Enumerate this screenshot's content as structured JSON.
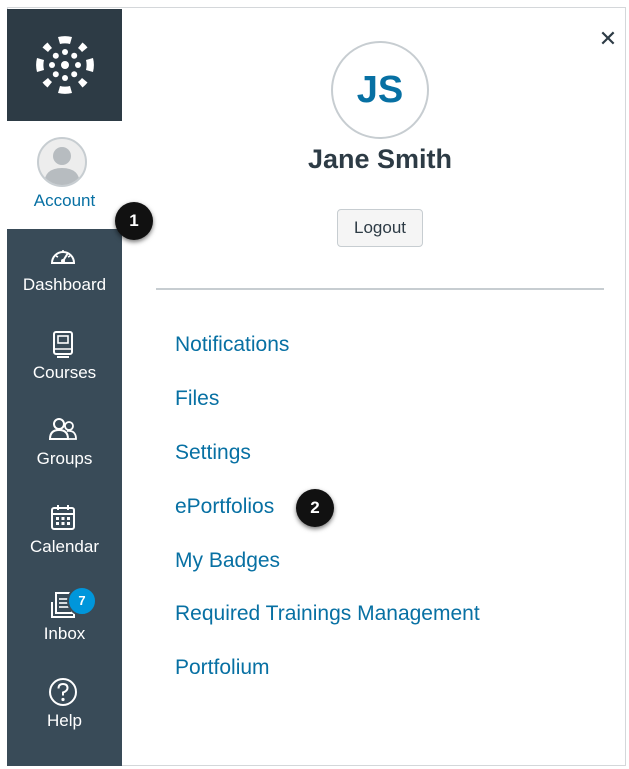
{
  "nav": {
    "logo_icon": "canvas-logo-icon",
    "account": {
      "label": "Account",
      "icon": "user-avatar-icon"
    },
    "items": [
      {
        "label": "Dashboard",
        "icon": "dashboard-gauge-icon"
      },
      {
        "label": "Courses",
        "icon": "book-icon"
      },
      {
        "label": "Groups",
        "icon": "users-icon"
      },
      {
        "label": "Calendar",
        "icon": "calendar-icon"
      },
      {
        "label": "Inbox",
        "icon": "inbox-icon",
        "badge": "7"
      },
      {
        "label": "Help",
        "icon": "help-question-icon"
      }
    ]
  },
  "tray": {
    "close_icon": "close-icon",
    "close_glyph": "✕",
    "avatar_initials": "JS",
    "user_name": "Jane Smith",
    "logout_label": "Logout",
    "links": [
      "Notifications",
      "Files",
      "Settings",
      "ePortfolios",
      "My Badges",
      "Required Trainings Management",
      "Portfolium"
    ]
  },
  "callouts": [
    "1",
    "2"
  ],
  "colors": {
    "nav_background": "#394b58",
    "logo_background": "#2d3b45",
    "link": "#0770a3",
    "badge": "#0096db",
    "callout": "#111111"
  }
}
